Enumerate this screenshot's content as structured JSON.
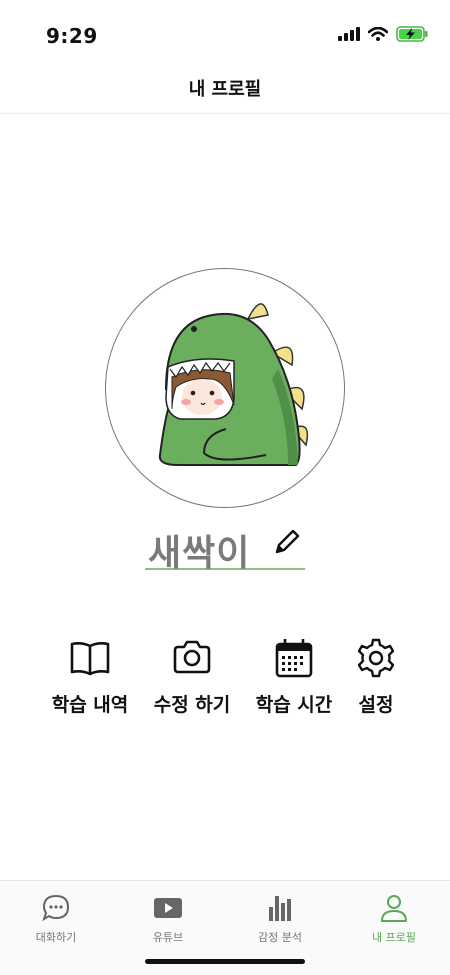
{
  "status_bar": {
    "time": "9:29",
    "battery_state": "charging",
    "icons": [
      "signal-icon",
      "wifi-icon",
      "battery-charging-icon"
    ]
  },
  "header": {
    "title": "내 프로필"
  },
  "profile": {
    "avatar": "green-dinosaur-costume-character",
    "nickname": "새싹이",
    "edit_icon": "pencil-icon"
  },
  "menu": [
    {
      "label": "학습 내역",
      "icon": "book-icon"
    },
    {
      "label": "수정 하기",
      "icon": "camera-icon"
    },
    {
      "label": "학습 시간",
      "icon": "calendar-icon"
    },
    {
      "label": "설정",
      "icon": "gear-icon"
    }
  ],
  "tabs": [
    {
      "label": "대화하기",
      "icon": "chat-bubble-icon",
      "active": false
    },
    {
      "label": "유튜브",
      "icon": "play-icon",
      "active": false
    },
    {
      "label": "감정 분석",
      "icon": "bar-chart-icon",
      "active": false
    },
    {
      "label": "내 프로필",
      "icon": "person-icon",
      "active": true
    }
  ],
  "colors": {
    "accent": "#5aa75a",
    "underline": "#8cc47e",
    "dino_green": "#6aae5e",
    "dino_spikes": "#f2e18a"
  }
}
